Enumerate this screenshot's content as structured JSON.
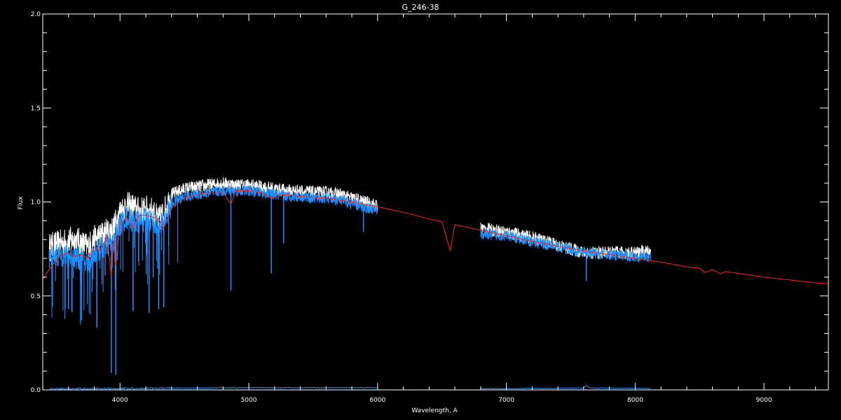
{
  "chart_data": {
    "type": "line",
    "title": "G_246-38",
    "xlabel": "Wavelength, A",
    "ylabel": "Flux",
    "xlim": [
      3400,
      9500
    ],
    "ylim": [
      0.0,
      2.0
    ],
    "x_ticks": [
      4000,
      5000,
      6000,
      7000,
      8000,
      9000
    ],
    "x_tick_labels": [
      "4000",
      "5000",
      "6000",
      "7000",
      "8000",
      "9000"
    ],
    "x_minor_step": 200,
    "y_ticks": [
      0.0,
      0.5,
      1.0,
      1.5,
      2.0
    ],
    "y_tick_labels": [
      "0.0",
      "0.5",
      "1.0",
      "1.5",
      "2.0"
    ],
    "y_minor_step": 0.1,
    "grid": false,
    "colors": {
      "background": "#000000",
      "axes": "#ffffff",
      "observed": "#ffffff",
      "fit": "#1e90ff",
      "model": "#ff2020",
      "error": "#1e90ff"
    },
    "series": [
      {
        "role": "model",
        "color": "#ff2020",
        "x": [
          3400,
          3450,
          3500,
          3550,
          3600,
          3650,
          3700,
          3750,
          3800,
          3850,
          3900,
          3933,
          3950,
          3968,
          4000,
          4050,
          4101,
          4150,
          4200,
          4250,
          4300,
          4340,
          4400,
          4500,
          4600,
          4700,
          4800,
          4861,
          4900,
          5000,
          5100,
          5175,
          5250,
          5400,
          5600,
          5800,
          6000,
          6200,
          6400,
          6500,
          6563,
          6600,
          6700,
          6800,
          7000,
          7200,
          7400,
          7600,
          7800,
          8000,
          8200,
          8400,
          8498,
          8542,
          8600,
          8662,
          8700,
          8800,
          9000,
          9200,
          9400,
          9500
        ],
        "y": [
          0.59,
          0.64,
          0.69,
          0.72,
          0.73,
          0.71,
          0.72,
          0.7,
          0.76,
          0.74,
          0.82,
          0.6,
          0.8,
          0.66,
          0.88,
          0.92,
          0.86,
          0.93,
          0.93,
          0.92,
          0.91,
          0.86,
          0.97,
          1.02,
          1.04,
          1.05,
          1.05,
          0.99,
          1.06,
          1.06,
          1.05,
          1.02,
          1.04,
          1.03,
          1.02,
          1.0,
          0.975,
          0.945,
          0.91,
          0.895,
          0.74,
          0.88,
          0.865,
          0.85,
          0.82,
          0.79,
          0.765,
          0.74,
          0.72,
          0.7,
          0.68,
          0.655,
          0.648,
          0.625,
          0.64,
          0.618,
          0.63,
          0.62,
          0.6,
          0.585,
          0.57,
          0.565
        ]
      },
      {
        "role": "observed",
        "color": "#ffffff",
        "segments": [
          {
            "x": [
              3450,
              3500,
              3550,
              3600,
              3650,
              3700,
              3750,
              3800,
              3850,
              3900,
              3950,
              4000,
              4050,
              4100,
              4150,
              4200,
              4250,
              4300,
              4350,
              4400,
              4500,
              4600,
              4700,
              4800,
              4900,
              5000,
              5100,
              5200,
              5300,
              5400,
              5500,
              5600,
              5700,
              5800,
              5900,
              6000
            ],
            "y": [
              0.76,
              0.77,
              0.78,
              0.79,
              0.8,
              0.78,
              0.76,
              0.8,
              0.82,
              0.84,
              0.86,
              0.95,
              0.98,
              0.97,
              0.95,
              0.96,
              0.95,
              0.9,
              0.96,
              1.04,
              1.07,
              1.08,
              1.09,
              1.1,
              1.09,
              1.09,
              1.08,
              1.07,
              1.06,
              1.06,
              1.05,
              1.05,
              1.04,
              1.02,
              1.0,
              0.98
            ]
          },
          {
            "x": [
              6800,
              7000,
              7200,
              7400,
              7600,
              7800,
              8000,
              8120
            ],
            "y": [
              0.86,
              0.84,
              0.81,
              0.77,
              0.73,
              0.73,
              0.73,
              0.74
            ]
          }
        ]
      },
      {
        "role": "fit",
        "color": "#1e90ff",
        "segments": [
          {
            "x": [
              3450,
              3500,
              3550,
              3600,
              3650,
              3700,
              3750,
              3800,
              3850,
              3900,
              3950,
              4000,
              4050,
              4100,
              4150,
              4200,
              4250,
              4300,
              4350,
              4400,
              4500,
              4600,
              4700,
              4800,
              4900,
              5000,
              5100,
              5200,
              5300,
              5400,
              5500,
              5600,
              5700,
              5800,
              5900,
              6000
            ],
            "y": [
              0.7,
              0.71,
              0.72,
              0.71,
              0.71,
              0.69,
              0.67,
              0.73,
              0.75,
              0.77,
              0.78,
              0.88,
              0.92,
              0.9,
              0.89,
              0.91,
              0.9,
              0.85,
              0.91,
              0.99,
              1.03,
              1.04,
              1.05,
              1.06,
              1.06,
              1.06,
              1.05,
              1.04,
              1.03,
              1.03,
              1.02,
              1.02,
              1.01,
              0.99,
              0.97,
              0.96
            ]
          },
          {
            "x": [
              6800,
              7000,
              7200,
              7400,
              7600,
              7800,
              8000,
              8120
            ],
            "y": [
              0.83,
              0.82,
              0.79,
              0.76,
              0.73,
              0.72,
              0.71,
              0.71
            ]
          }
        ],
        "absorption_lines": [
          {
            "x": 3933,
            "y": 0.09
          },
          {
            "x": 3968,
            "y": 0.08
          },
          {
            "x": 3820,
            "y": 0.33
          },
          {
            "x": 3700,
            "y": 0.37
          },
          {
            "x": 3600,
            "y": 0.43
          },
          {
            "x": 4101,
            "y": 0.42
          },
          {
            "x": 4226,
            "y": 0.41
          },
          {
            "x": 4300,
            "y": 0.43
          },
          {
            "x": 4340,
            "y": 0.44
          },
          {
            "x": 4861,
            "y": 0.53
          },
          {
            "x": 5175,
            "y": 0.62
          },
          {
            "x": 5270,
            "y": 0.78
          },
          {
            "x": 5890,
            "y": 0.84
          },
          {
            "x": 7620,
            "y": 0.58
          }
        ]
      },
      {
        "role": "error",
        "color": "#1e90ff",
        "segments": [
          {
            "x": [
              3450,
              4000,
              5000,
              6000
            ],
            "y": [
              0.005,
              0.008,
              0.012,
              0.012
            ]
          },
          {
            "x": [
              6800,
              7600,
              7620,
              7650,
              8120
            ],
            "y": [
              0.006,
              0.01,
              0.025,
              0.01,
              0.008
            ]
          }
        ]
      }
    ]
  }
}
